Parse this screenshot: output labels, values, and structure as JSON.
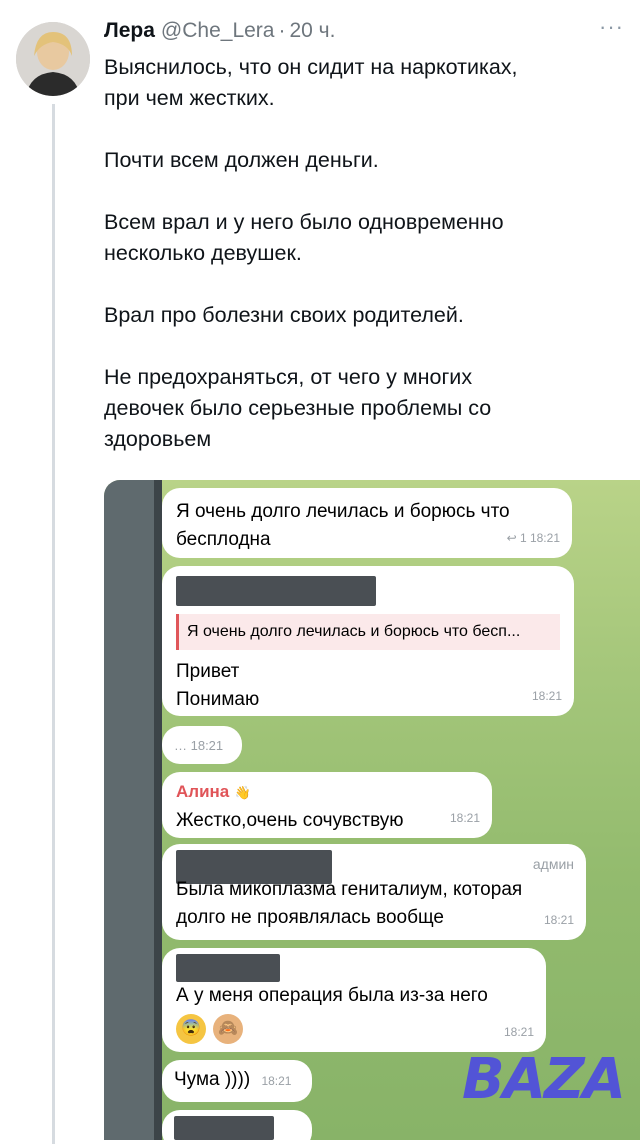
{
  "tweet": {
    "author_name": "Лера",
    "handle": "@Che_Lera",
    "separator": "·",
    "time": "20 ч.",
    "more": "···",
    "paragraphs": [
      [
        "Выяснилось, что он сидит на наркотиках,",
        "при чем жестких."
      ],
      [
        "Почти всем должен деньги."
      ],
      [
        "Всем врал и у него было одновременно",
        "несколько девушек."
      ],
      [
        "Врал про болезни своих родителей."
      ],
      [
        "Не предохраняться, от чего у многих",
        "девочек было серьезные проблемы со",
        "здоровьем"
      ]
    ]
  },
  "chat": {
    "messages": [
      {
        "lines": [
          "Я очень долго лечилась и борюсь что",
          "бесплодна"
        ],
        "meta": "↩ 1  18:21"
      },
      {
        "quote": "Я очень долго лечилась и борюсь что бесп...",
        "lines": [
          "Привет",
          "Понимаю"
        ],
        "time": "18:21"
      },
      {
        "text": "…  18:21"
      },
      {
        "sender": "Алина",
        "sender_emoji": "👋",
        "text": "Жестко,очень сочувствую",
        "time": "18:21"
      },
      {
        "role": "админ",
        "lines": [
          "Была микоплазма гениталиум, которая",
          "долго не проявлялась вообще"
        ],
        "time": "18:21"
      },
      {
        "text": "А у меня операция была из-за него",
        "emoji": [
          "😨",
          "🙈"
        ],
        "time": "18:21"
      },
      {
        "text": "Чума ))))",
        "time": "18:21"
      }
    ]
  },
  "watermark": "BAZA"
}
